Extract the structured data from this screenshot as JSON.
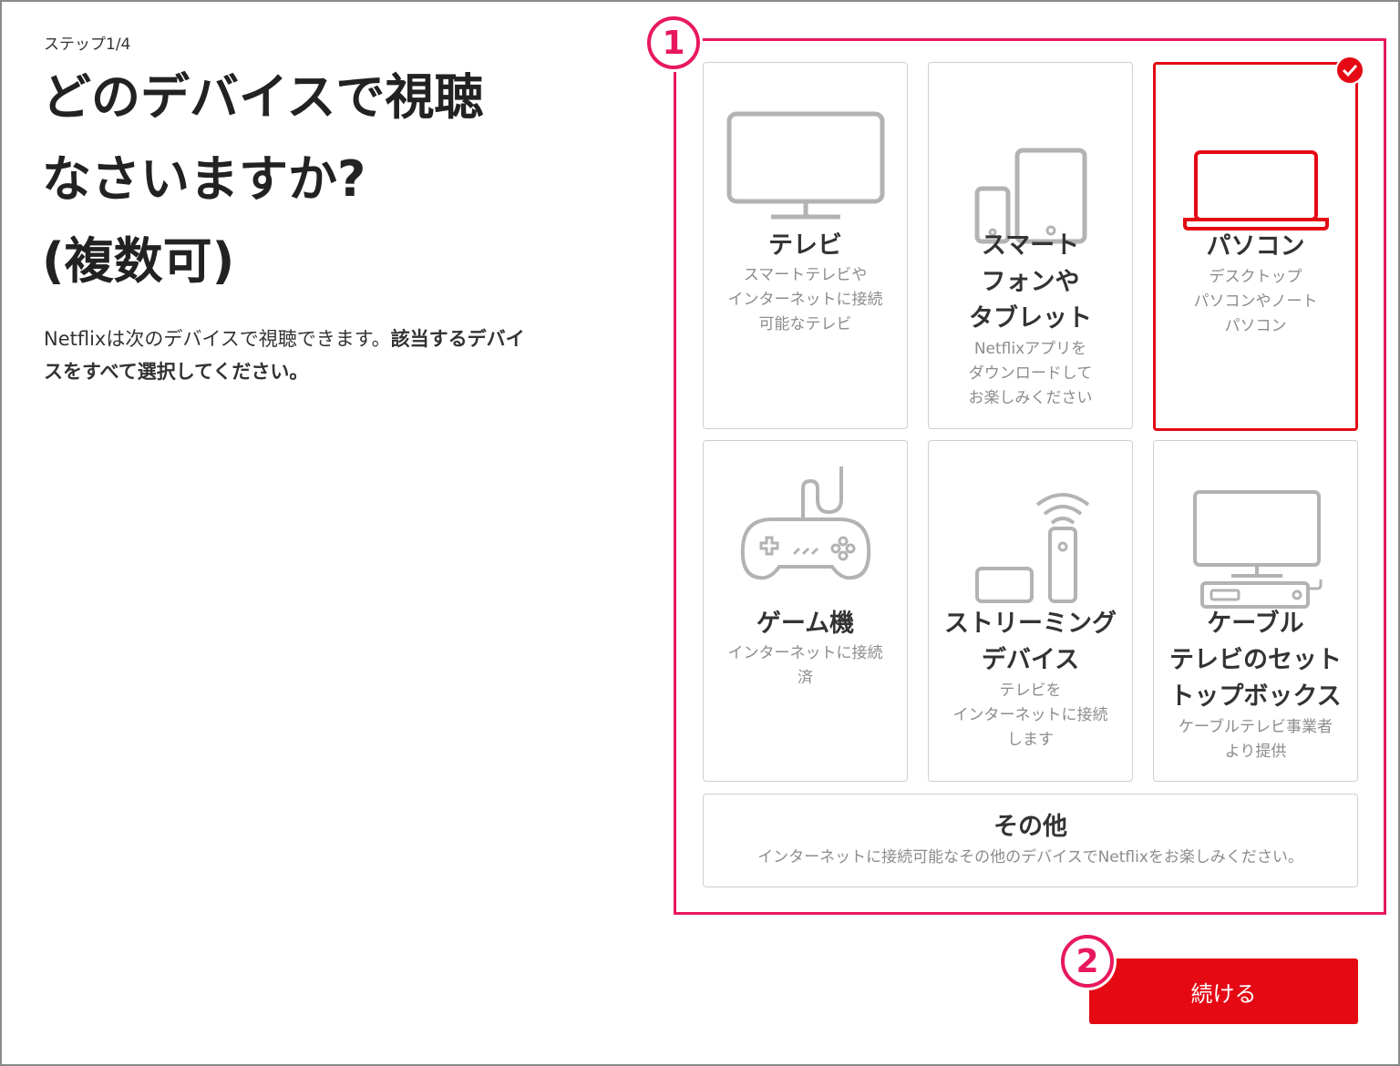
{
  "header": {
    "step": "ステップ1/4",
    "title_lines": [
      "どのデバイスで視聴",
      "なさいますか?",
      "(複数可)"
    ],
    "desc_normal": "Netflixは次のデバイスで視聴できます。",
    "desc_bold": "該当するデバイスをすべて選択してください。"
  },
  "annotations": {
    "badge1": "1",
    "badge2": "2"
  },
  "devices": [
    {
      "name": "テレビ",
      "sub": [
        "スマートテレビや",
        "インターネットに接続",
        "可能なテレビ"
      ],
      "selected": false,
      "icon": "tv-icon"
    },
    {
      "name": [
        "スマート",
        "フォンや",
        "タブレット"
      ],
      "sub": [
        "Netflixアプリを",
        "ダウンロードして",
        "お楽しみください"
      ],
      "selected": false,
      "icon": "phone-tablet-icon"
    },
    {
      "name": "パソコン",
      "sub": [
        "デスクトップ",
        "パソコンやノート",
        "パソコン"
      ],
      "selected": true,
      "icon": "laptop-icon"
    },
    {
      "name": "ゲーム機",
      "sub": [
        "インターネットに接続",
        "済"
      ],
      "selected": false,
      "icon": "game-controller-icon"
    },
    {
      "name": [
        "ストリーミング",
        "デバイス"
      ],
      "sub": [
        "テレビを",
        "インターネットに接続",
        "します"
      ],
      "selected": false,
      "icon": "streaming-device-icon"
    },
    {
      "name": [
        "ケーブル",
        "テレビのセット",
        "トップボックス"
      ],
      "sub": [
        "ケーブルテレビ事業者",
        "より提供"
      ],
      "selected": false,
      "icon": "set-top-box-icon"
    },
    {
      "name": "その他",
      "sub": [
        "インターネットに接続可能なその他のデバイスでNetflixをお楽しみください。"
      ],
      "selected": false,
      "icon": ""
    }
  ],
  "continue_label": "続ける",
  "colors": {
    "accent": "#e50914",
    "highlight": "#e8185c",
    "icon_gray": "#b3b3b3"
  }
}
